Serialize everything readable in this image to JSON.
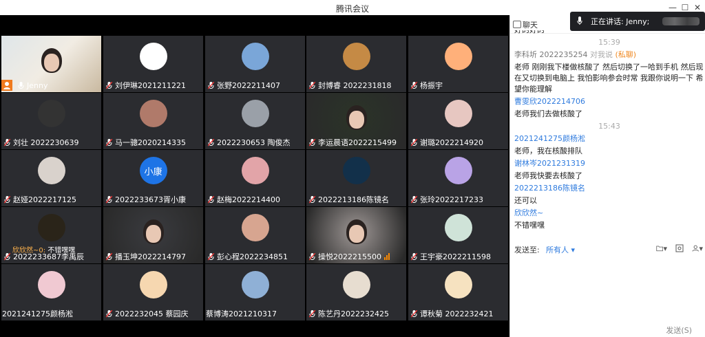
{
  "window": {
    "title": "腾讯会议"
  },
  "participants": [
    {
      "name": "Jenny",
      "feed": "camera",
      "host": true,
      "bg": "#e9e2d6"
    },
    {
      "name": "刘伊琳2021211221",
      "bg": "#f3d5d8",
      "av": "#fff"
    },
    {
      "name": "张野2022211407",
      "bg": "#7aa6d8",
      "av": "#7aa6d8"
    },
    {
      "name": "封博睿 2022231818",
      "bg": "#c58a45",
      "av": "#c58a45"
    },
    {
      "name": "杨振宇",
      "bg": "#ffc38a",
      "av": "#ffb07a"
    },
    {
      "name": "刘壮 2022230639",
      "bg": "#222",
      "av": "#333"
    },
    {
      "name": "马一骢2020214335",
      "bg": "#b07a6a",
      "av": "#b07a6a"
    },
    {
      "name": "2022230653 陶俊杰",
      "bg": "#9aa0a8",
      "av": "#9aa0a8"
    },
    {
      "name": "李运晨语2022215499",
      "feed": "camera",
      "bg": "#2b3428"
    },
    {
      "name": "谢璐2022214920",
      "bg": "#e7c7c1",
      "av": "#e7c7c1"
    },
    {
      "name": "赵娅2022217125",
      "bg": "#d9d2cc",
      "av": "#d9d2cc"
    },
    {
      "name": "2022233673胥小康",
      "bg": "#1e74e6",
      "av": "#1e74e6",
      "initials": "小康"
    },
    {
      "name": "赵梅2022214400",
      "bg": "#e2a4a8",
      "av": "#e2a4a8"
    },
    {
      "name": "2022213186陈镜名",
      "bg": "#12304a",
      "av": "#12304a"
    },
    {
      "name": "张玲2022217233",
      "bg": "#b9a3e6",
      "av": "#b9a3e6"
    },
    {
      "name": "2022233687李禹辰",
      "bg": "#1a1a1a",
      "av": "#2a2419",
      "overlay_sender": "欣欣然~0:",
      "overlay_msg": "不错嘿嘿"
    },
    {
      "name": "播玉坤2022214797",
      "feed": "camera",
      "bg": "#3a3b3f"
    },
    {
      "name": "彭心程2022234851",
      "bg": "#d7a590",
      "av": "#d7a590"
    },
    {
      "name": "操悦2022215500",
      "feed": "camera",
      "bg": "#9f9896",
      "signal": true
    },
    {
      "name": "王宇豪2022211598",
      "bg": "#cfe3d8",
      "av": "#cfe3d8"
    },
    {
      "name": "2021241275颜杨淞",
      "bg": "#f0c9d2",
      "av": "#f0c9d2",
      "nomic": true
    },
    {
      "name": "2022232045 蔡园庆",
      "bg": "#f6d7b0",
      "av": "#f6d7b0"
    },
    {
      "name": "蔡博涛2021210317",
      "bg": "#8fb0d6",
      "av": "#8fb0d6",
      "nomic": true
    },
    {
      "name": "陈艺丹2022232425",
      "bg": "#e7ddd0",
      "av": "#e7ddd0"
    },
    {
      "name": "谭秋菊 2022232421",
      "bg": "#f6e2c0",
      "av": "#f6e2c0"
    }
  ],
  "chat": {
    "header_label": "聊天",
    "speaking": "正在讲话: Jenny;",
    "send_to_label": "发送至:",
    "send_to_value": "所有人",
    "send_button": "发送(S)",
    "messages": [
      {
        "type": "text",
        "text": "好的好的",
        "cls": "body"
      },
      {
        "type": "ts",
        "text": "15:39"
      },
      {
        "type": "sender",
        "text": "李科圻 2022235254",
        "suffix": "对我说",
        "priv": "(私聊)"
      },
      {
        "type": "text",
        "text": "老师 刚刚我下楼做核酸了 然后切换了一哈到手机 然后现在又切换到电脑上 我怕影响参会时常 我跟你说明一下 希望你能理解",
        "cls": "body"
      },
      {
        "type": "link",
        "text": "曹雯欣2022214706"
      },
      {
        "type": "text",
        "text": "老师我们去做核酸了",
        "cls": "body"
      },
      {
        "type": "ts",
        "text": "15:43"
      },
      {
        "type": "link",
        "text": "2021241275颜杨淞"
      },
      {
        "type": "text",
        "text": "老师，我在核酸排队",
        "cls": "body"
      },
      {
        "type": "link",
        "text": "谢林岑2021231319"
      },
      {
        "type": "text",
        "text": "老师我快要去核酸了",
        "cls": "body"
      },
      {
        "type": "link",
        "text": "2022213186陈镜名"
      },
      {
        "type": "text",
        "text": "还可以",
        "cls": "body"
      },
      {
        "type": "link",
        "text": "欣欣然~"
      },
      {
        "type": "text",
        "text": "不错嘿嘿",
        "cls": "body"
      }
    ]
  }
}
